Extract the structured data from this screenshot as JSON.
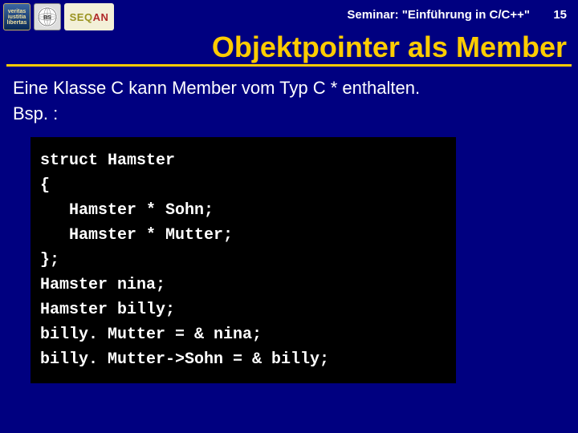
{
  "header": {
    "seminar": "Seminar: \"Einführung in C/C++\"",
    "slide_number": "15",
    "logo1_text": "veritas\niustitia\nlibertas",
    "logo3_seq": "SEQ",
    "logo3_an": "AN"
  },
  "title": "Objektpointer als Member",
  "intro_line1": "Eine Klasse C kann Member vom Typ C * enthalten.",
  "intro_line2": "Bsp. :",
  "code": "struct Hamster\n{\n   Hamster * Sohn;\n   Hamster * Mutter;\n};\nHamster nina;\nHamster billy;\nbilly. Mutter = & nina;\nbilly. Mutter->Sohn = & billy;"
}
